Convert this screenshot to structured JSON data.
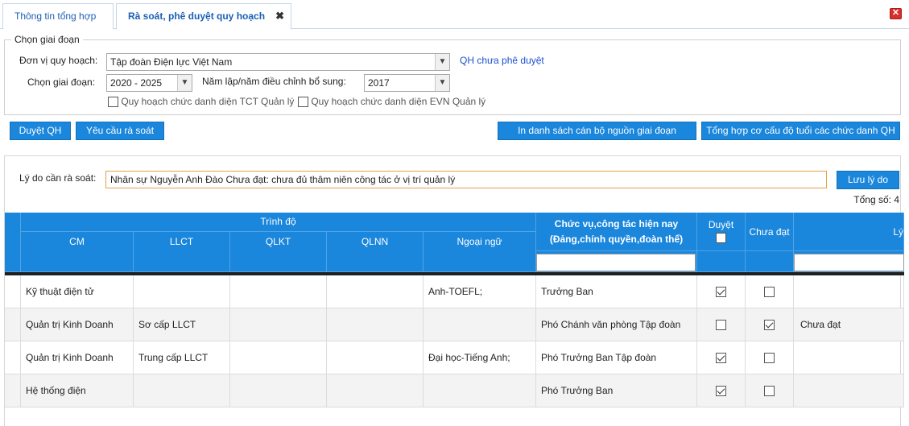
{
  "tabs": [
    {
      "label": "Thông tin tổng hợp"
    },
    {
      "label": "Rà soát, phê duyệt quy hoạch",
      "close": "✖"
    }
  ],
  "window_close": "✕",
  "stage": {
    "legend": "Chọn giai đoạn",
    "unit_label": "Đơn vị quy hoạch:",
    "unit_value": "Tập đoàn Điện lực Việt Nam",
    "status_link": "QH chưa phê duyệt",
    "period_label": "Chọn giai đoạn:",
    "period_value": "2020 - 2025",
    "year_label": "Năm lập/năm điều chỉnh bổ sung:",
    "year_value": "2017",
    "check_tct": "Quy hoạch chức danh diện TCT Quản lý",
    "check_evn": "Quy hoạch chức danh diện EVN Quản lý"
  },
  "toolbar": {
    "approve": "Duyệt QH",
    "request_review": "Yêu cầu rà soát",
    "print_list": "In danh sách cán bộ nguồn giai đoạn",
    "age_summary": "Tổng hợp cơ cấu độ tuổi các chức danh QH"
  },
  "review": {
    "reason_label": "Lý do cần rà soát:",
    "reason_value": "Nhân sự Nguyễn Anh Đào Chưa đạt: chưa đủ thâm niên công tác ở vị trí quản lý",
    "save_label": "Lưu lý do",
    "total": "Tổng số: 4"
  },
  "grid": {
    "group_header": "Trình độ",
    "columns": [
      "CM",
      "LLCT",
      "QLKT",
      "QLNN",
      "Ngoại ngữ"
    ],
    "position_header": "Chức vụ,công tác hiện nay (Đảng,chính quyền,đoàn thể)",
    "approve_header": "Duyệt",
    "not_passed_header": "Chưa đạt",
    "reason_header": "Lý",
    "rows": [
      {
        "cm": "Kỹ thuật điện tử",
        "llct": "",
        "qlkt": "",
        "qlnn": "",
        "nn": "Anh-TOEFL;",
        "position": "Trưởng Ban",
        "approved": true,
        "not_passed": false,
        "reason": ""
      },
      {
        "cm": "Quản trị Kinh Doanh",
        "llct": "Sơ cấp LLCT",
        "qlkt": "",
        "qlnn": "",
        "nn": "",
        "position": "Phó Chánh văn phòng Tập đoàn",
        "approved": false,
        "not_passed": true,
        "reason": "Chưa đạt"
      },
      {
        "cm": "Quản trị Kinh Doanh",
        "llct": "Trung cấp LLCT",
        "qlkt": "",
        "qlnn": "",
        "nn": "Đại học-Tiếng Anh;",
        "position": "Phó Trưởng Ban Tập đoàn",
        "approved": true,
        "not_passed": false,
        "reason": ""
      },
      {
        "cm": "Hệ thống điện",
        "llct": "",
        "qlkt": "",
        "qlnn": "",
        "nn": "",
        "position": "Phó Trưởng Ban",
        "approved": true,
        "not_passed": false,
        "reason": ""
      }
    ]
  },
  "colors": {
    "accent": "#1a86dc",
    "link": "#1a4fd0",
    "close": "#d8302c"
  }
}
